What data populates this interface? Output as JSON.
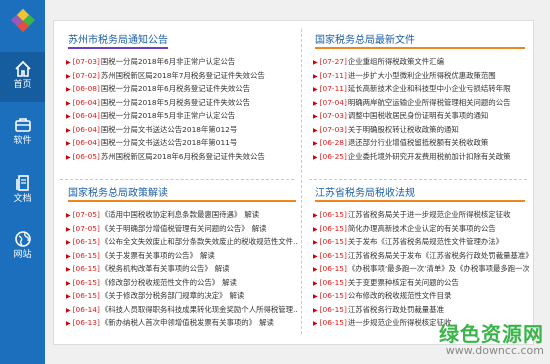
{
  "sidebar": {
    "items": [
      {
        "label": "首页",
        "icon": "home-icon"
      },
      {
        "label": "软件",
        "icon": "software-icon"
      },
      {
        "label": "文档",
        "icon": "document-icon"
      },
      {
        "label": "网站",
        "icon": "website-icon"
      }
    ]
  },
  "panels": {
    "top_left": {
      "title": "苏州市税务局通知公告",
      "items": [
        {
          "date": "[07-03]",
          "text": "国税一分局2018年6月非正常户认定公告"
        },
        {
          "date": "[07-02]",
          "text": "苏州国税新区局2018年7月税务登记证件失效公告"
        },
        {
          "date": "[06-08]",
          "text": "国税一分局2018年6月税务登记证件失效公告"
        },
        {
          "date": "[06-04]",
          "text": "国税一分局2018年5月税务登记证件失效公告"
        },
        {
          "date": "[06-04]",
          "text": "国税一分局2018年5月非正常户认定公告"
        },
        {
          "date": "[06-04]",
          "text": "国税一分局文书送达公告2018年第012号"
        },
        {
          "date": "[06-04]",
          "text": "国税一分局文书送达公告2018年第011号"
        },
        {
          "date": "[06-05]",
          "text": "苏州国税新区局2018年6月税务登记证件失效公告"
        }
      ]
    },
    "top_right": {
      "title": "国家税务总局最新文件",
      "items": [
        {
          "date": "[07-27]",
          "text": "企业重组所得税政策文件汇编"
        },
        {
          "date": "[07-11]",
          "text": "进一步扩大小型微利企业所得税优惠政策范围"
        },
        {
          "date": "[07-11]",
          "text": "延长高新技术企业和科技型中小企业亏损结转年限"
        },
        {
          "date": "[07-04]",
          "text": "明确两岸航空运输企业所得税管理相关问题的公告"
        },
        {
          "date": "[07-03]",
          "text": "调整中国税收居民身份证明有关事项的通知"
        },
        {
          "date": "[07-03]",
          "text": "关于明确股权转让税收政策的通知"
        },
        {
          "date": "[06-28]",
          "text": "退还部分行业增值税留抵税额有关税收政策"
        },
        {
          "date": "[06-25]",
          "text": "企业委托境外研究开发费用税前加计扣除有关政策"
        }
      ]
    },
    "bottom_left": {
      "title": "国家税务总局政策解读",
      "more": "解读",
      "items": [
        {
          "date": "[07-05]",
          "text": "《适用中国税收协定利息条款最惠国待遇》"
        },
        {
          "date": "[07-05]",
          "text": "《关于明确部分增值税管理有关问题的公告》"
        },
        {
          "date": "[06-15]",
          "text": "《公布全文失效废止和部分条款失效废止的税收规范性文件…"
        },
        {
          "date": "[06-15]",
          "text": "《关于发票有关事项的公告》"
        },
        {
          "date": "[06-15]",
          "text": "《税务机构改革有关事项的公告》"
        },
        {
          "date": "[06-15]",
          "text": "《修改部分税收规范性文件的公告》"
        },
        {
          "date": "[06-15]",
          "text": "《关于修改部分税务部门规章的决定》"
        },
        {
          "date": "[06-14]",
          "text": "《科技人员取得职务科技成果转化现金奖励个人所得税管理…"
        },
        {
          "date": "[06-13]",
          "text": "《新办纳税人首次申领增值税发票有关事项的》"
        }
      ]
    },
    "bottom_right": {
      "title": "江苏省税务局税收法规",
      "items": [
        {
          "date": "[06-15]",
          "text": "江苏省税务局关于进一步规范企业所得税核定征收"
        },
        {
          "date": "[06-15]",
          "text": "简化办理高新技术企业认定的有关事项的公告"
        },
        {
          "date": "[06-15]",
          "text": "关于发布《江苏省税务局规范性文件管理办法》"
        },
        {
          "date": "[06-15]",
          "text": "江苏省税务局关于发布《江苏省税务行政处罚裁量基准》"
        },
        {
          "date": "[06-15]",
          "text": "《办税事项‘最多跑一次’清单》及《办税事项最多跑一次清单》"
        },
        {
          "date": "[06-15]",
          "text": "关于变更票种核定有关问题的公告"
        },
        {
          "date": "[06-15]",
          "text": "公布修改的税收规范性文件目录"
        },
        {
          "date": "[06-15]",
          "text": "江苏省税务行政处罚裁量基准"
        },
        {
          "date": "[06-15]",
          "text": "进一步规范企业所得税核定征收"
        }
      ]
    }
  },
  "watermark": {
    "cn": "绿色资源网",
    "url": "www.downcc.com"
  },
  "colors": {
    "sidebar": "#1c6fbd",
    "date_red": "#e01b1b",
    "title_blue": "#1d5fa8",
    "underline_purple": "#6a3fc8",
    "underline_orange": "#f0861f"
  }
}
